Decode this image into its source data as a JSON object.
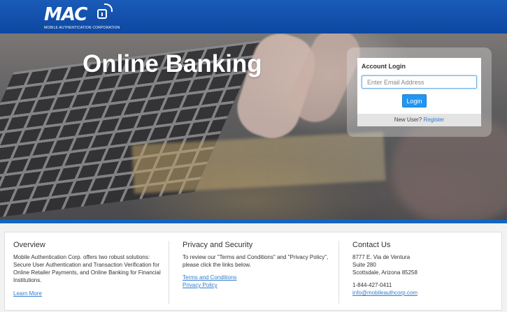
{
  "brand": {
    "logo_text": "MAC",
    "tagline": "MOBILE AUTHENTICATION CORPORATION"
  },
  "hero": {
    "title": "Online Banking"
  },
  "login": {
    "title": "Account Login",
    "email_placeholder": "Enter Email Address",
    "button_label": "Login",
    "new_user_text": "New User?",
    "register_link": "Register"
  },
  "overview": {
    "heading": "Overview",
    "body": "Mobile Authentication Corp. offers two robust solutions: Secure User Authentication and Transaction Verification for Online Retailer Payments, and Online Banking for Financial Institutions.",
    "link": "Learn More"
  },
  "privacy": {
    "heading": "Privacy and Security",
    "body": "To review our \"Terms and Conditions\" and \"Privacy Policy\", please click the links below.",
    "terms_link": "Terms and Conditions",
    "policy_link": "Privacy Policy"
  },
  "contact": {
    "heading": "Contact Us",
    "address1": "8777 E. Via de Ventura",
    "address2": "Suite 280",
    "address3": "Scottsdale, Arizona 85258",
    "phone": "1-844-427-0411",
    "email": "info@mobileauthcorp.com"
  },
  "colors": {
    "header": "#0d47a1",
    "accent": "#2196f3",
    "link": "#2e7dd1"
  }
}
